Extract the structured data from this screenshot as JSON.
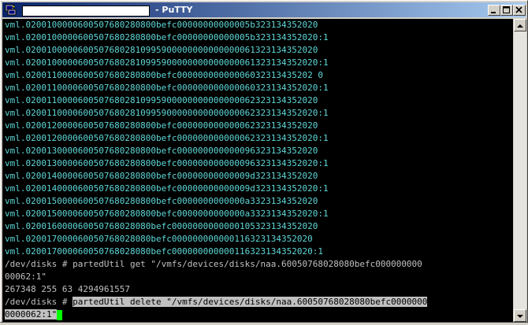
{
  "window": {
    "title": "- PuTTY",
    "buttons": {
      "minimize": "minimize",
      "maximize": "maximize",
      "close": "close"
    }
  },
  "terminal": {
    "output_lines": [
      "vml.0200100000600507680280800befc00000000000005b323134352020",
      "vml.0200100000600507680280800befc00000000000005b323134352020:1",
      "vml.02001000006005076802810995900000000000000061323134352020",
      "vml.02001000006005076802810995900000000000000061323134352020:1",
      "vml.0200110000600507680280800befc00000000000006032313435202 0",
      "vml.0200110000600507680280800befc000000000000060323134352020:1",
      "vml.02001100006005076802810995900000000000000062323134352020",
      "vml.02001100006005076802810995900000000000000062323134352020:1",
      "vml.0200120000600507680280800befc000000000000062323134352020",
      "vml.0200120000600507680280800befc000000000000062323134352020:1",
      "vml.0200130000600507680280800befc000000000000096323134352020",
      "vml.0200130000600507680280800befc000000000000096323134352020:1",
      "vml.0200140000600507680280800befc00000000000009d323134352020",
      "vml.0200140000600507680280800befc00000000000009d323134352020:1",
      "vml.0200150000600507680280800befc0000000000000a3323134352020",
      "vml.0200150000600507680280800befc0000000000000a3323134352020:1",
      "vml.020016000060050768028080befc0000000000000105323134352020",
      "vml.020017000060050768028080befc000000000000116323134352020",
      "vml.020017000060050768028080befc000000000000116323134352020:1"
    ],
    "command1_line1": "/dev/disks # partedUtil get \"/vmfs/devices/disks/naa.60050768028080befc000000000",
    "command1_line2": "00062:1\"",
    "result_line": "267348 255 63 4294961557",
    "prompt": "/dev/disks # ",
    "command2_line1": "partedUtil delete \"/vmfs/devices/disks/naa.60050768028080befc0000000",
    "command2_line2": "0000062:1\"",
    "colors": {
      "output": "#5fd7d7",
      "text": "#c0c0c0",
      "cursor": "#00ff00",
      "selection": "#c0c0c0"
    }
  },
  "icons": [
    "putty-icon",
    "minimize-icon",
    "maximize-icon",
    "close-icon",
    "scroll-up-icon",
    "scroll-down-icon"
  ]
}
